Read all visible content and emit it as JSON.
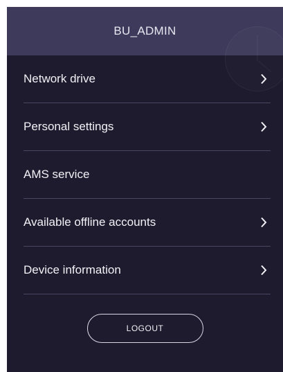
{
  "header": {
    "title": "BU_ADMIN"
  },
  "menu": {
    "items": [
      {
        "label": "Network drive",
        "has_chevron": true,
        "icon": "chevron-right-icon"
      },
      {
        "label": "Personal settings",
        "has_chevron": true,
        "icon": "chevron-right-icon"
      },
      {
        "label": "AMS service",
        "has_chevron": false
      },
      {
        "label": "Available offline accounts",
        "has_chevron": true,
        "icon": "chevron-right-icon"
      },
      {
        "label": "Device information",
        "has_chevron": true,
        "icon": "chevron-right-icon"
      }
    ]
  },
  "actions": {
    "logout_label": "LOGOUT"
  },
  "colors": {
    "panel_bg": "#1e1b2e",
    "header_bg": "#3e3a5b",
    "divider": "#4a4660",
    "text": "#f2f1f6"
  },
  "decor": {
    "header_watermark": "clock-icon"
  }
}
